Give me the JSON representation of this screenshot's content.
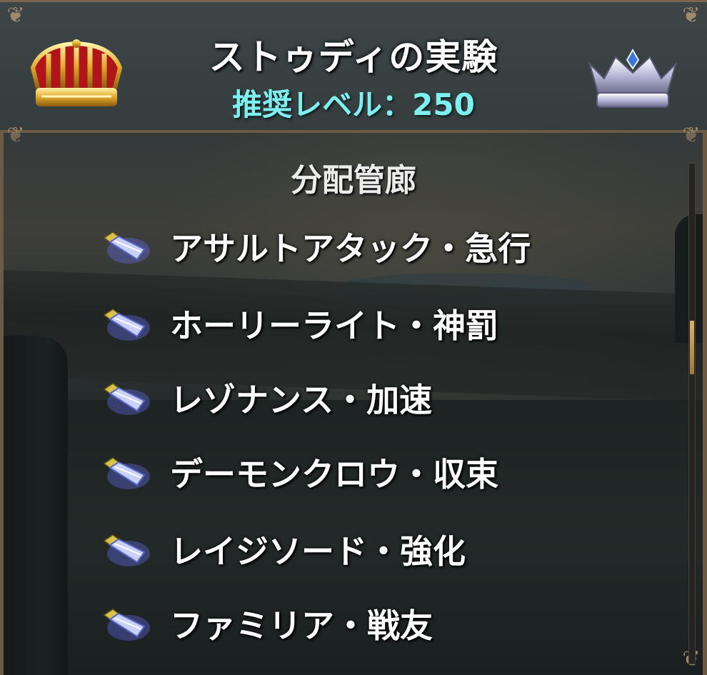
{
  "header": {
    "title": "ストゥディの実験",
    "recommended_level": "推奨レベル：250",
    "left_crown_icon": "gold-crown-icon",
    "right_crown_icon": "silver-crown-icon"
  },
  "section": {
    "title": "分配管廊"
  },
  "items": [
    {
      "label": "アサルトアタック・急行",
      "icon": "blue-crystal-icon"
    },
    {
      "label": "ホーリーライト・神罰",
      "icon": "blue-crystal-icon"
    },
    {
      "label": "レゾナンス・加速",
      "icon": "blue-crystal-icon"
    },
    {
      "label": "デーモンクロウ・収束",
      "icon": "blue-crystal-icon"
    },
    {
      "label": "レイジソード・強化",
      "icon": "blue-crystal-icon"
    },
    {
      "label": "ファミリア・戦友",
      "icon": "blue-crystal-icon"
    }
  ],
  "colors": {
    "level_text": "#7ff0f0",
    "frame": "#6b5a45",
    "scroll_thumb": "#d7b36a"
  }
}
